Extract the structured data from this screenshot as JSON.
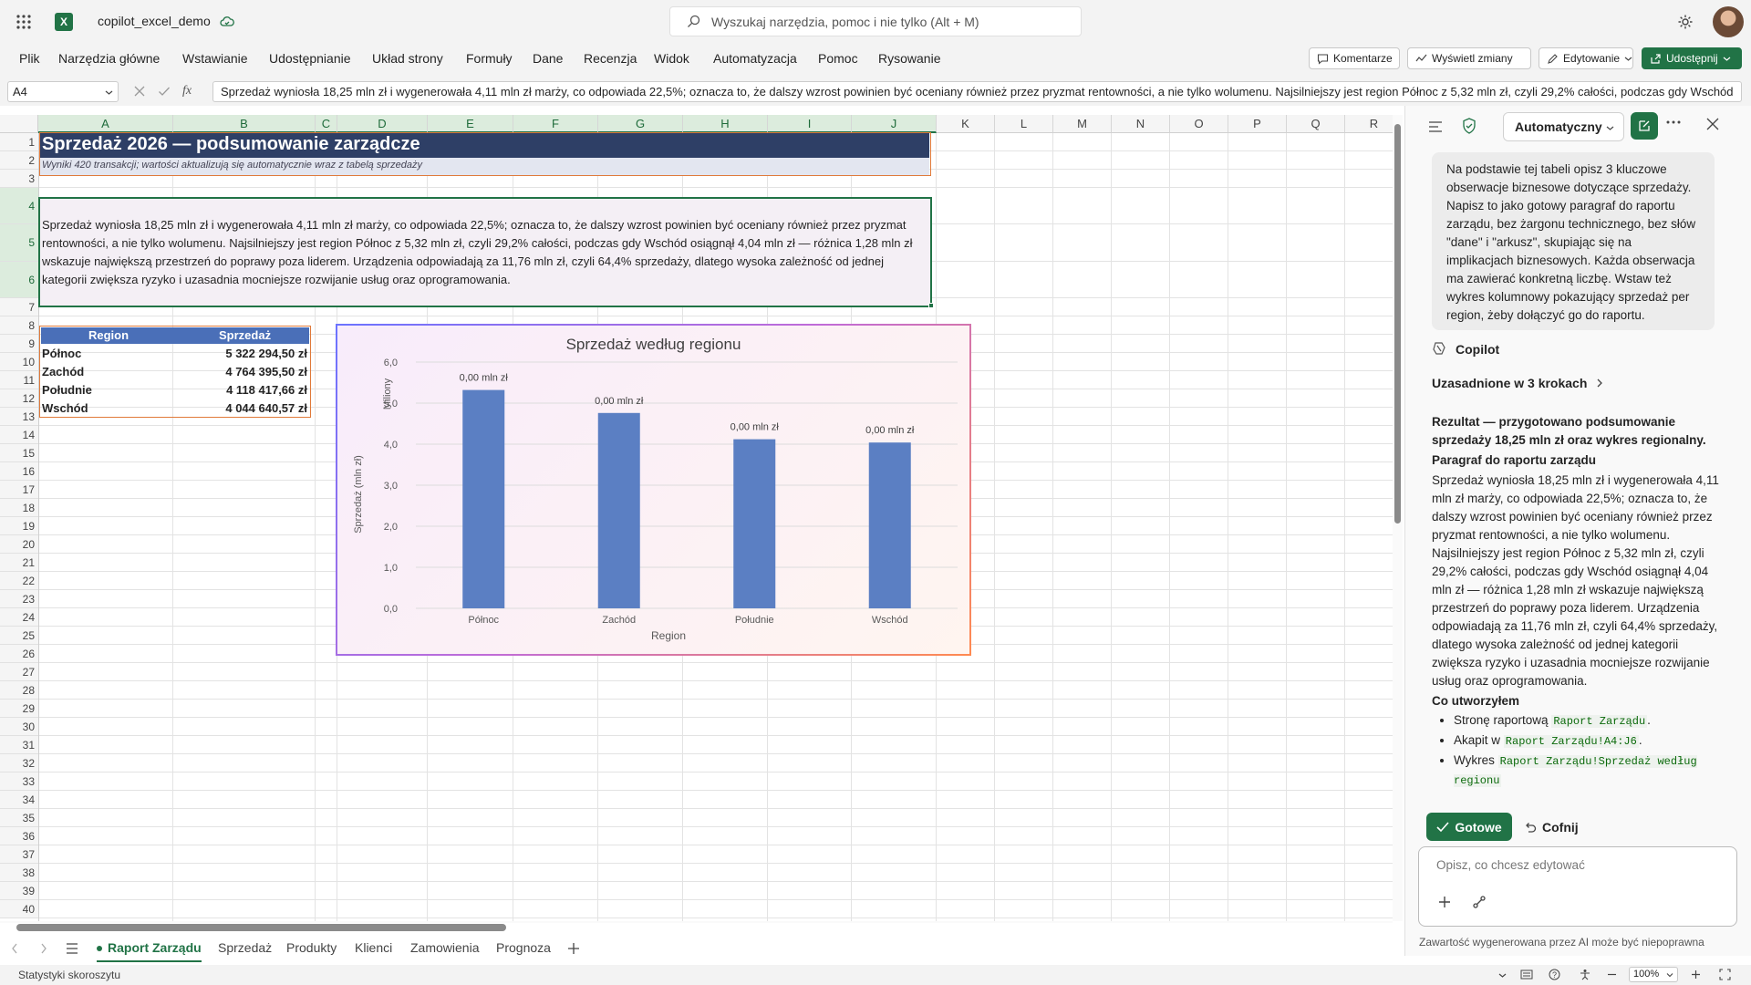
{
  "app": {
    "file_name": "copilot_excel_demo",
    "search_placeholder": "Wyszukaj narzędzia, pomoc i nie tylko (Alt + M)"
  },
  "ribbon": {
    "tabs": [
      "Plik",
      "Narzędzia główne",
      "Wstawianie",
      "Udostępnianie",
      "Układ strony",
      "Formuły",
      "Dane",
      "Recenzja",
      "Widok",
      "Automatyzacja",
      "Pomoc",
      "Rysowanie"
    ],
    "comments": "Komentarze",
    "show_changes": "Wyświetl zmiany",
    "editing": "Edytowanie",
    "share": "Udostępnij"
  },
  "formula_bar": {
    "name_box": "A4",
    "fx": "fx",
    "formula": "Sprzedaż wyniosła 18,25 mln zł i wygenerowała 4,11 mln zł marży, co odpowiada 22,5%; oznacza to, że dalszy wzrost powinien być oceniany również przez pryzmat rentowności, a nie tylko wolumenu. Najsilniejszy jest region Północ z 5,32 mln zł, czyli 29,2% całości, podczas gdy Wschód"
  },
  "grid": {
    "columns": [
      "A",
      "B",
      "C",
      "D",
      "E",
      "F",
      "G",
      "H",
      "I",
      "J",
      "K",
      "L",
      "M",
      "N",
      "O",
      "P",
      "Q",
      "R"
    ],
    "rows": [
      "1",
      "2",
      "3",
      "4",
      "5",
      "6",
      "7",
      "8",
      "9",
      "10",
      "11",
      "12",
      "13",
      "14",
      "15",
      "16",
      "17",
      "18",
      "19",
      "20",
      "21",
      "22",
      "23",
      "24",
      "25",
      "26",
      "27",
      "28",
      "29",
      "30",
      "31",
      "32",
      "33",
      "34",
      "35",
      "36",
      "37",
      "38",
      "39",
      "40"
    ],
    "title": "Sprzedaż 2026 — podsumowanie zarządcze",
    "subtitle": "Wyniki 420 transakcji; wartości aktualizują się automatycznie wraz z tabelą sprzedaży",
    "paragraph": "Sprzedaż wyniosła 18,25 mln zł i wygenerowała 4,11 mln zł marży, co odpowiada 22,5%; oznacza to, że dalszy wzrost powinien być oceniany również przez pryzmat rentowności, a nie tylko wolumenu. Najsilniejszy jest region Północ z 5,32 mln zł, czyli 29,2% całości, podczas gdy Wschód osiągnął 4,04 mln zł — różnica 1,28 mln zł wskazuje największą przestrzeń do poprawy poza liderem. Urządzenia odpowiadają za 11,76 mln zł, czyli 64,4% sprzedaży, dlatego wysoka zależność od jednej kategorii zwiększa ryzyko i uzasadnia mocniejsze rozwijanie usług oraz oprogramowania.",
    "table": {
      "headers": [
        "Region",
        "Sprzedaż"
      ],
      "rows": [
        [
          "Północ",
          "5 322 294,50 zł"
        ],
        [
          "Zachód",
          "4 764 395,50 zł"
        ],
        [
          "Południe",
          "4 118 417,66 zł"
        ],
        [
          "Wschód",
          "4 044 640,57 zł"
        ]
      ]
    }
  },
  "chart_data": {
    "type": "bar",
    "title": "Sprzedaż według regionu",
    "categories": [
      "Północ",
      "Zachód",
      "Południe",
      "Wschód"
    ],
    "values": [
      5.32,
      4.76,
      4.12,
      4.04
    ],
    "data_labels": [
      "0,00 mln zł",
      "0,00 mln zł",
      "0,00 mln zł",
      "0,00 mln zł"
    ],
    "xlabel": "Region",
    "ylabel": "Sprzedaż (mln zł)",
    "unit_label": "Miliony",
    "yticks": [
      "0,0",
      "1,0",
      "2,0",
      "3,0",
      "4,0",
      "5,0",
      "6,0"
    ],
    "ylim": [
      0,
      6
    ],
    "grid": true,
    "bar_color": "#5b7fc3"
  },
  "copilot": {
    "mode": "Automatyczny",
    "user_prompt": "Na podstawie tej tabeli opisz 3 kluczowe obserwacje biznesowe dotyczące sprzedaży. Napisz to jako gotowy paragraf do raportu zarządu, bez żargonu technicznego, bez słów \"dane\" i \"arkusz\", skupiając się na implikacjach biznesowych. Każda obserwacja ma zawierać konkretną liczbę. Wstaw też wykres kolumnowy pokazujący sprzedaż per region, żeby dołączyć go do raportu.",
    "name": "Copilot",
    "grounded": "Uzasadnione w 3 krokach",
    "result": "Rezultat — przygotowano podsumowanie sprzedaży 18,25 mln zł oraz wykres regionalny.",
    "paragraph_heading": "Paragraf do raportu zarządu",
    "paragraph": "Sprzedaż wyniosła 18,25 mln zł i wygenerowała 4,11 mln zł marży, co odpowiada 22,5%; oznacza to, że dalszy wzrost powinien być oceniany również przez pryzmat rentowności, a nie tylko wolumenu. Najsilniejszy jest region Północ z 5,32 mln zł, czyli 29,2% całości, podczas gdy Wschód osiągnął 4,04 mln zł — różnica 1,28 mln zł wskazuje największą przestrzeń do poprawy poza liderem. Urządzenia odpowiadają za 11,76 mln zł, czyli 64,4% sprzedaży, dlatego wysoka zależność od jednej kategorii zwiększa ryzyko i uzasadnia mocniejsze rozwijanie usług oraz oprogramowania.",
    "created_heading": "Co utworzyłem",
    "created": [
      {
        "text": "Stronę raportową",
        "code": "Raport Zarządu",
        "end": "."
      },
      {
        "text": "Akapit w",
        "code": "Raport Zarządu!A4:J6",
        "end": "."
      },
      {
        "text": "Wykres",
        "code": "Raport Zarządu!Sprzedaż według regionu",
        "end": ""
      }
    ],
    "done": "Gotowe",
    "undo": "Cofnij",
    "input_placeholder": "Opisz, co chcesz edytować",
    "disclaimer": "Zawartość wygenerowana przez AI może być niepoprawna"
  },
  "sheets": {
    "tabs": [
      "Raport Zarządu",
      "Sprzedaż",
      "Produkty",
      "Klienci",
      "Zamowienia",
      "Prognoza"
    ],
    "active": "Raport Zarządu"
  },
  "status": {
    "left": "Statystyki skoroszytu",
    "zoom": "100%"
  },
  "colors": {
    "excel_green": "#217346",
    "title_bg": "#2e3f66",
    "header_blue": "#4a6fb8"
  }
}
